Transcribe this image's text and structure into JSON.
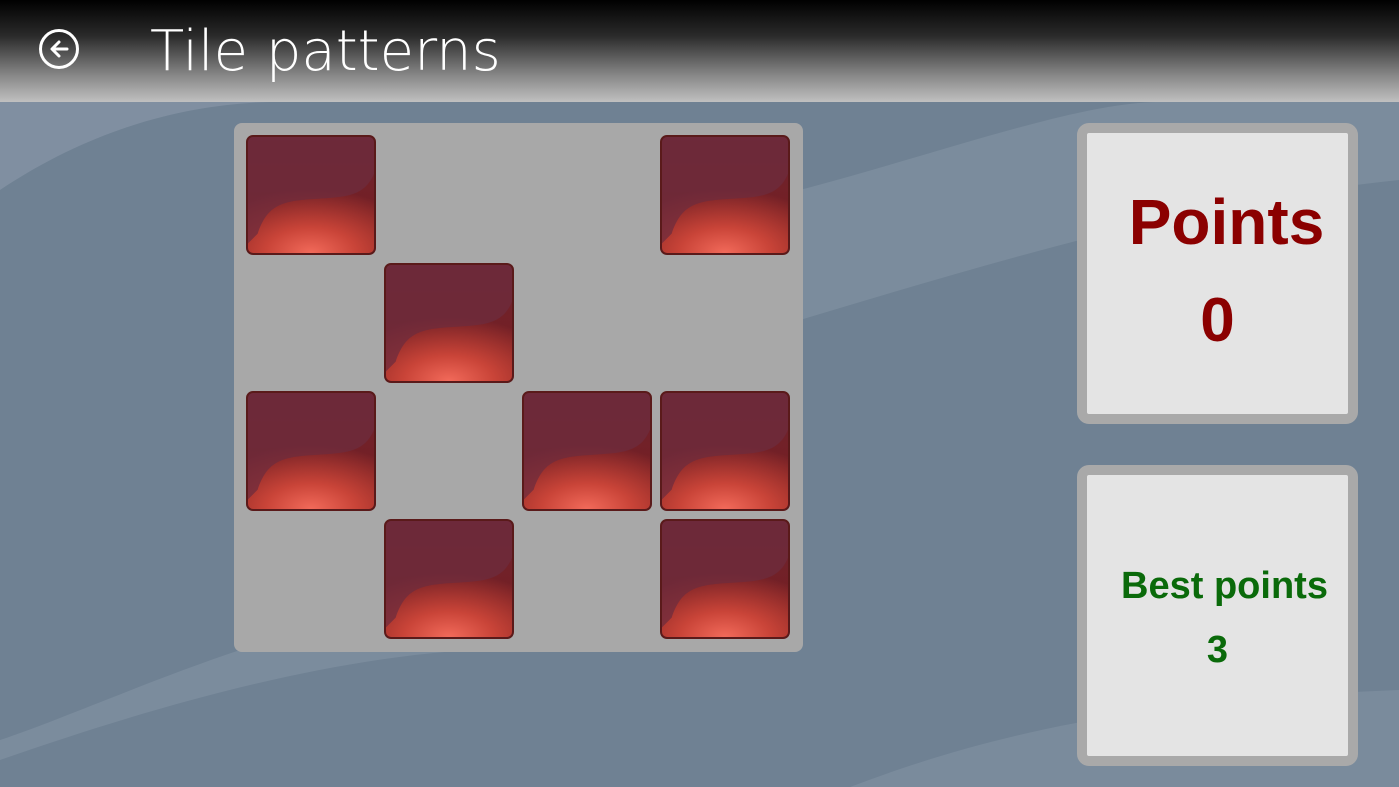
{
  "header": {
    "title": "Tile patterns",
    "back_icon": "back-arrow-icon"
  },
  "board": {
    "rows": 4,
    "columns": 4,
    "tiles": [
      {
        "row": 0,
        "col": 0,
        "active": true
      },
      {
        "row": 0,
        "col": 1,
        "active": false
      },
      {
        "row": 0,
        "col": 2,
        "active": false
      },
      {
        "row": 0,
        "col": 3,
        "active": true
      },
      {
        "row": 1,
        "col": 0,
        "active": false
      },
      {
        "row": 1,
        "col": 1,
        "active": true
      },
      {
        "row": 1,
        "col": 2,
        "active": false
      },
      {
        "row": 1,
        "col": 3,
        "active": false
      },
      {
        "row": 2,
        "col": 0,
        "active": true
      },
      {
        "row": 2,
        "col": 1,
        "active": false
      },
      {
        "row": 2,
        "col": 2,
        "active": true
      },
      {
        "row": 2,
        "col": 3,
        "active": true
      },
      {
        "row": 3,
        "col": 0,
        "active": false
      },
      {
        "row": 3,
        "col": 1,
        "active": true
      },
      {
        "row": 3,
        "col": 2,
        "active": false
      },
      {
        "row": 3,
        "col": 3,
        "active": true
      }
    ],
    "tile_color": "#b8362f"
  },
  "score": {
    "points_label": "Points",
    "points_value": "0",
    "points_color": "#8b0000",
    "best_label": "Best points",
    "best_value": "3",
    "best_color": "#0a6a0a"
  },
  "colors": {
    "background": "#6f8193",
    "board": "#a8a8a8",
    "panel": "#e4e4e4"
  }
}
